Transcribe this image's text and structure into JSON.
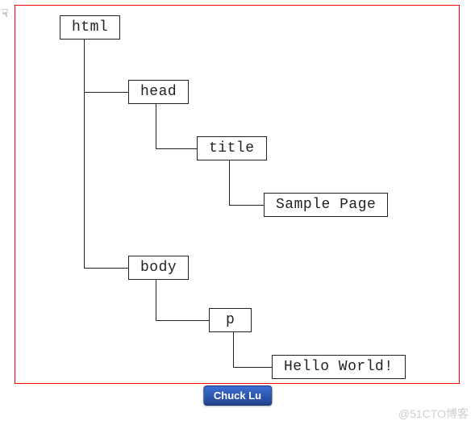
{
  "tree": {
    "html_label": "html",
    "head_label": "head",
    "title_label": "title",
    "sample_label": "Sample Page",
    "body_label": "body",
    "p_label": "p",
    "hello_label": "Hello World!"
  },
  "author_chip": "Chuck Lu",
  "watermark": "@51CTO博客",
  "cursor_glyph": "☟"
}
